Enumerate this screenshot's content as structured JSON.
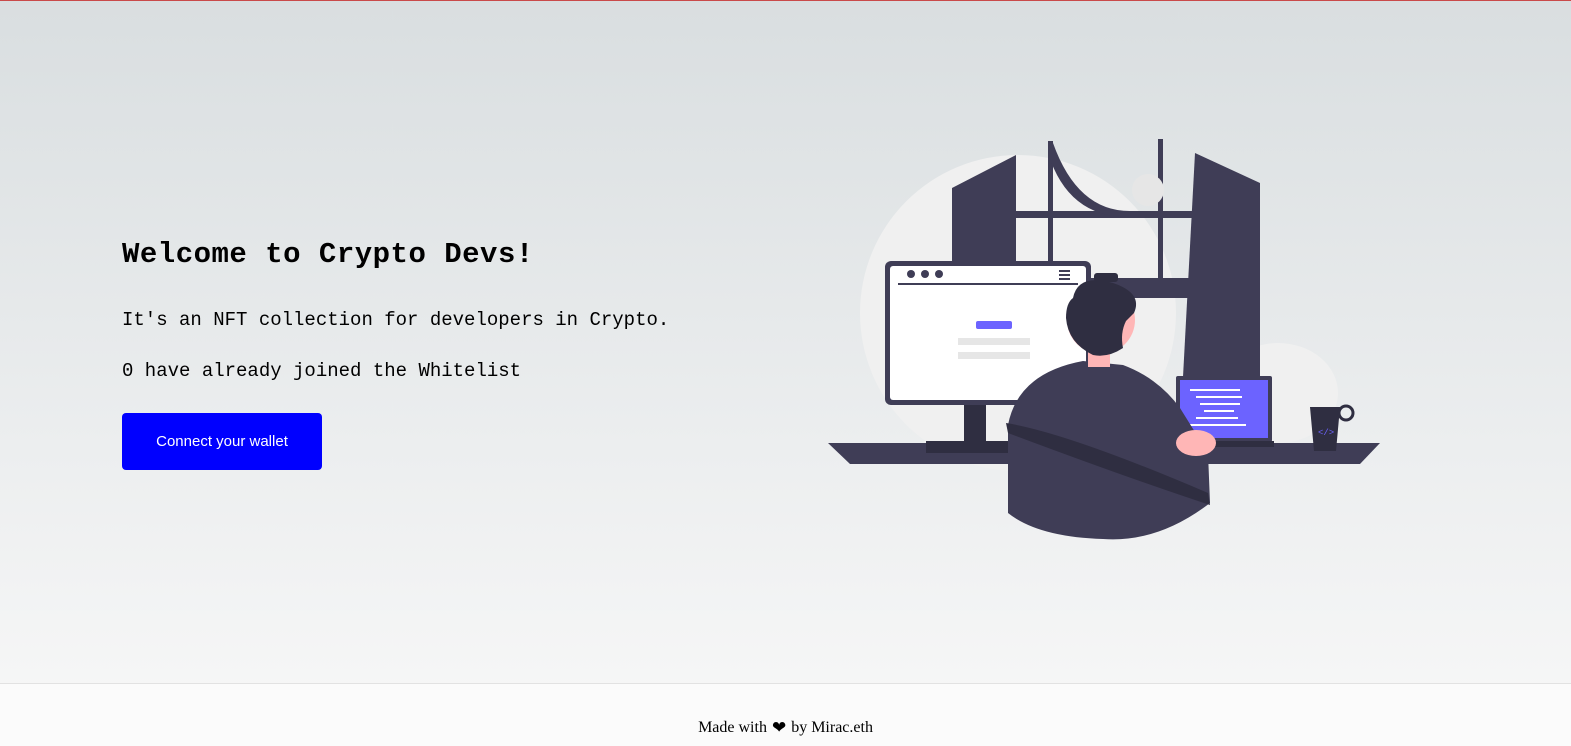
{
  "hero": {
    "title": "Welcome to Crypto Devs!",
    "description": "It's an NFT collection for developers in Crypto.",
    "whitelist_count": "0 have already joined the Whitelist",
    "connect_button": "Connect your wallet"
  },
  "footer": {
    "made_with": "Made with",
    "heart": "❤",
    "by": "by Mirac.eth"
  },
  "colors": {
    "button": "#0000ff",
    "illustration_dark": "#3f3d56",
    "illustration_accent": "#6c63ff",
    "skin": "#ffb6b6"
  },
  "illustration": {
    "icon": "developer-at-desk-illustration"
  }
}
